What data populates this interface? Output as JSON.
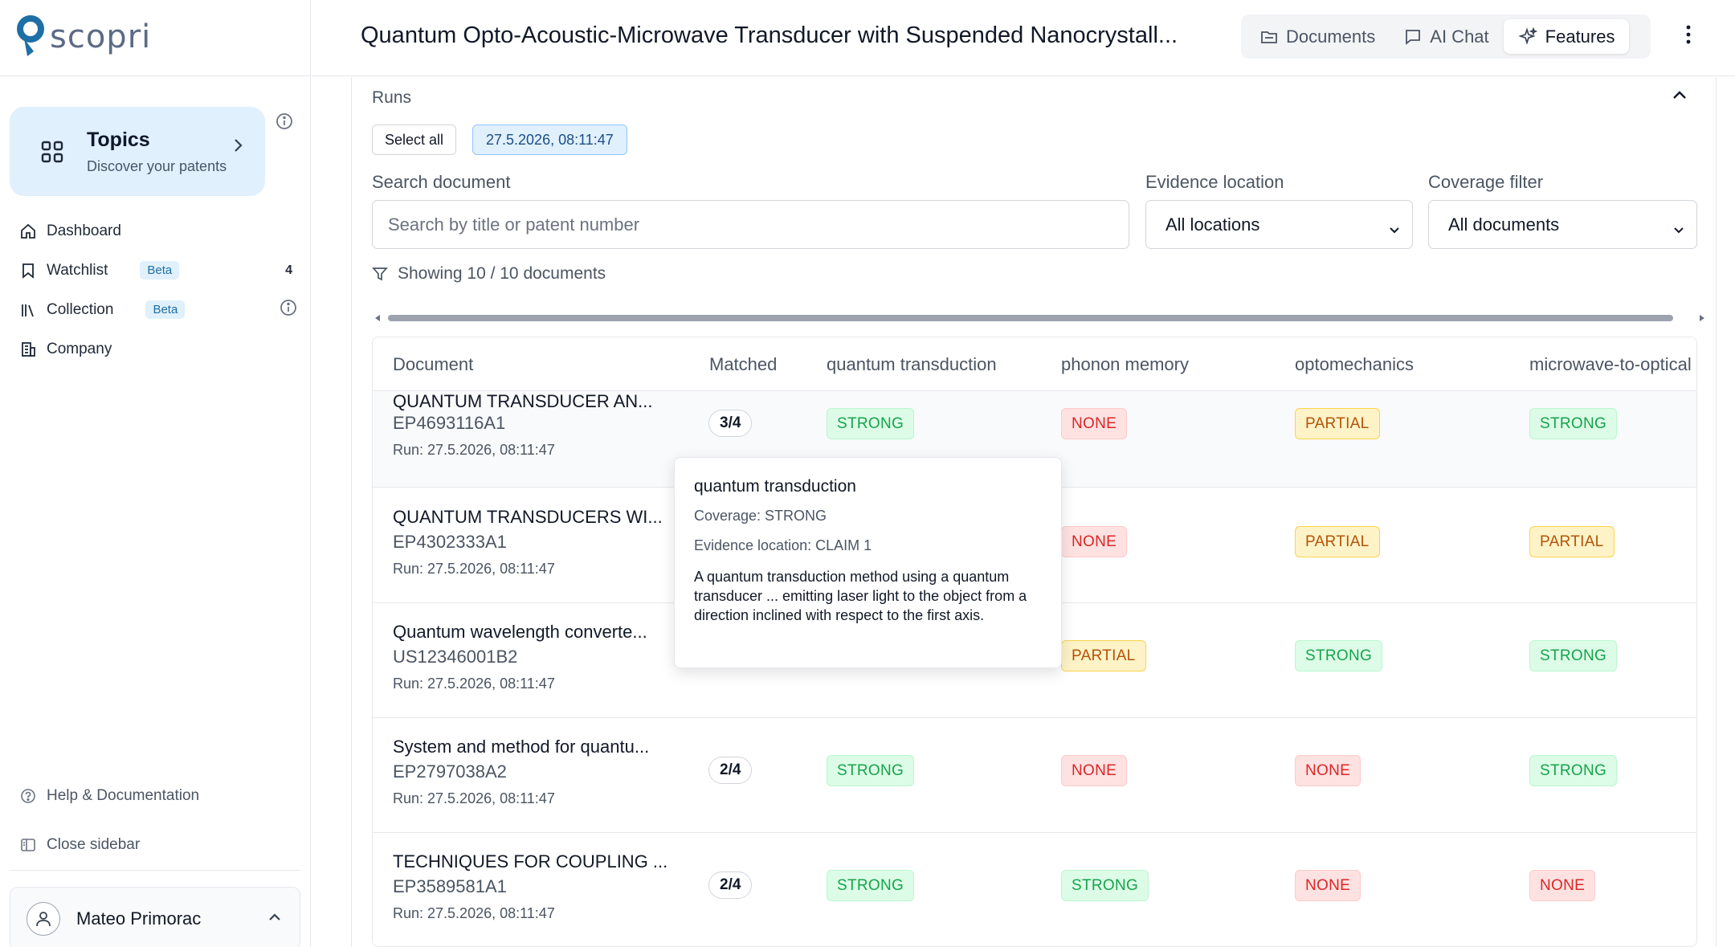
{
  "brand": {
    "name": "scopri",
    "accent": "#1d6fa5"
  },
  "sidebar": {
    "topics": {
      "title": "Topics",
      "subtitle": "Discover your patents"
    },
    "items": [
      {
        "label": "Dashboard",
        "icon": "home-icon"
      },
      {
        "label": "Watchlist",
        "icon": "bookmark-icon",
        "badge": "Beta",
        "count": "4"
      },
      {
        "label": "Collection",
        "icon": "library-icon",
        "badge": "Beta"
      },
      {
        "label": "Company",
        "icon": "building-icon"
      }
    ],
    "bottom": [
      {
        "label": "Help & Documentation",
        "icon": "help-icon"
      },
      {
        "label": "Close sidebar",
        "icon": "sidebar-icon"
      }
    ],
    "user": {
      "name": "Mateo Primorac"
    }
  },
  "header": {
    "title": "Quantum Opto-Acoustic-Microwave Transducer with Suspended Nanocrystall...",
    "tabs": [
      {
        "label": "Documents",
        "icon": "folder-icon",
        "active": false
      },
      {
        "label": "AI Chat",
        "icon": "chat-icon",
        "active": false
      },
      {
        "label": "Features",
        "icon": "sparkle-icon",
        "active": true
      }
    ]
  },
  "runs": {
    "label": "Runs",
    "select_all": "Select all",
    "selected_run": "27.5.2026, 08:11:47"
  },
  "filters": {
    "search_label": "Search document",
    "search_placeholder": "Search by title or patent number",
    "evidence_label": "Evidence location",
    "evidence_value": "All locations",
    "coverage_label": "Coverage filter",
    "coverage_value": "All documents",
    "showing": "Showing 10 / 10 documents"
  },
  "table": {
    "columns": [
      "Document",
      "Matched",
      "quantum transduction",
      "phonon memory",
      "optomechanics",
      "microwave-to-optical"
    ],
    "rows": [
      {
        "title": "QUANTUM TRANSDUCER AN...",
        "number": "EP4693116A1",
        "run": "Run: 27.5.2026, 08:11:47",
        "matched": "3/4",
        "coverage": [
          "STRONG",
          "NONE",
          "PARTIAL",
          "STRONG"
        ]
      },
      {
        "title": "QUANTUM TRANSDUCERS WI...",
        "number": "EP4302333A1",
        "run": "Run: 27.5.2026, 08:11:47",
        "matched": "",
        "coverage": [
          "",
          "NONE",
          "PARTIAL",
          "PARTIAL"
        ]
      },
      {
        "title": "Quantum wavelength converte...",
        "number": "US12346001B2",
        "run": "Run: 27.5.2026, 08:11:47",
        "matched": "",
        "coverage": [
          "",
          "PARTIAL",
          "STRONG",
          "STRONG"
        ]
      },
      {
        "title": "System and method for quantu...",
        "number": "EP2797038A2",
        "run": "Run: 27.5.2026, 08:11:47",
        "matched": "2/4",
        "coverage": [
          "STRONG",
          "NONE",
          "NONE",
          "STRONG"
        ]
      },
      {
        "title": "TECHNIQUES FOR COUPLING ...",
        "number": "EP3589581A1",
        "run": "Run: 27.5.2026, 08:11:47",
        "matched": "2/4",
        "coverage": [
          "STRONG",
          "STRONG",
          "NONE",
          "NONE"
        ]
      }
    ]
  },
  "tooltip": {
    "title": "quantum transduction",
    "coverage": "Coverage: STRONG",
    "evidence": "Evidence location: CLAIM 1",
    "body": "A quantum transduction method using a quantum transducer ... emitting laser light to the object from a direction inclined with respect to the first axis."
  }
}
